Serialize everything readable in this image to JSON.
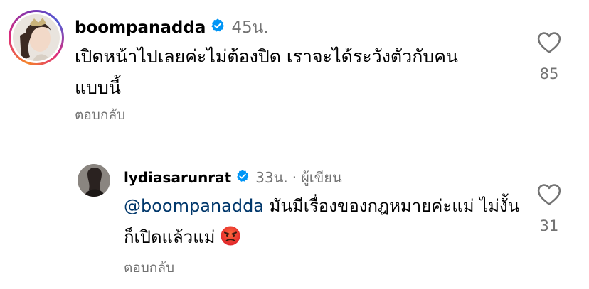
{
  "comments": [
    {
      "username": "boompanadda",
      "time": "45น.",
      "text": "เปิดหน้าไปเลยค่ะไม่ต้องปิด เราจะได้ระวังตัวกับคน แบบนี้",
      "reply_label": "ตอบกลับ",
      "like_count": "85"
    },
    {
      "username": "lydiasarunrat",
      "time": "33น.",
      "author_badge": "ผู้เขียน",
      "mention": "@boompanadda",
      "text": "มันมีเรื่องของกฎหมายค่ะแม่ ไม่งั้นก็เปิดแล้วแม่",
      "emoji": "angry-face-icon",
      "reply_label": "ตอบกลับ",
      "like_count": "31"
    }
  ],
  "colors": {
    "text": "#000000",
    "secondary": "#737373",
    "verified": "#0095f6",
    "mention": "#00376b"
  }
}
